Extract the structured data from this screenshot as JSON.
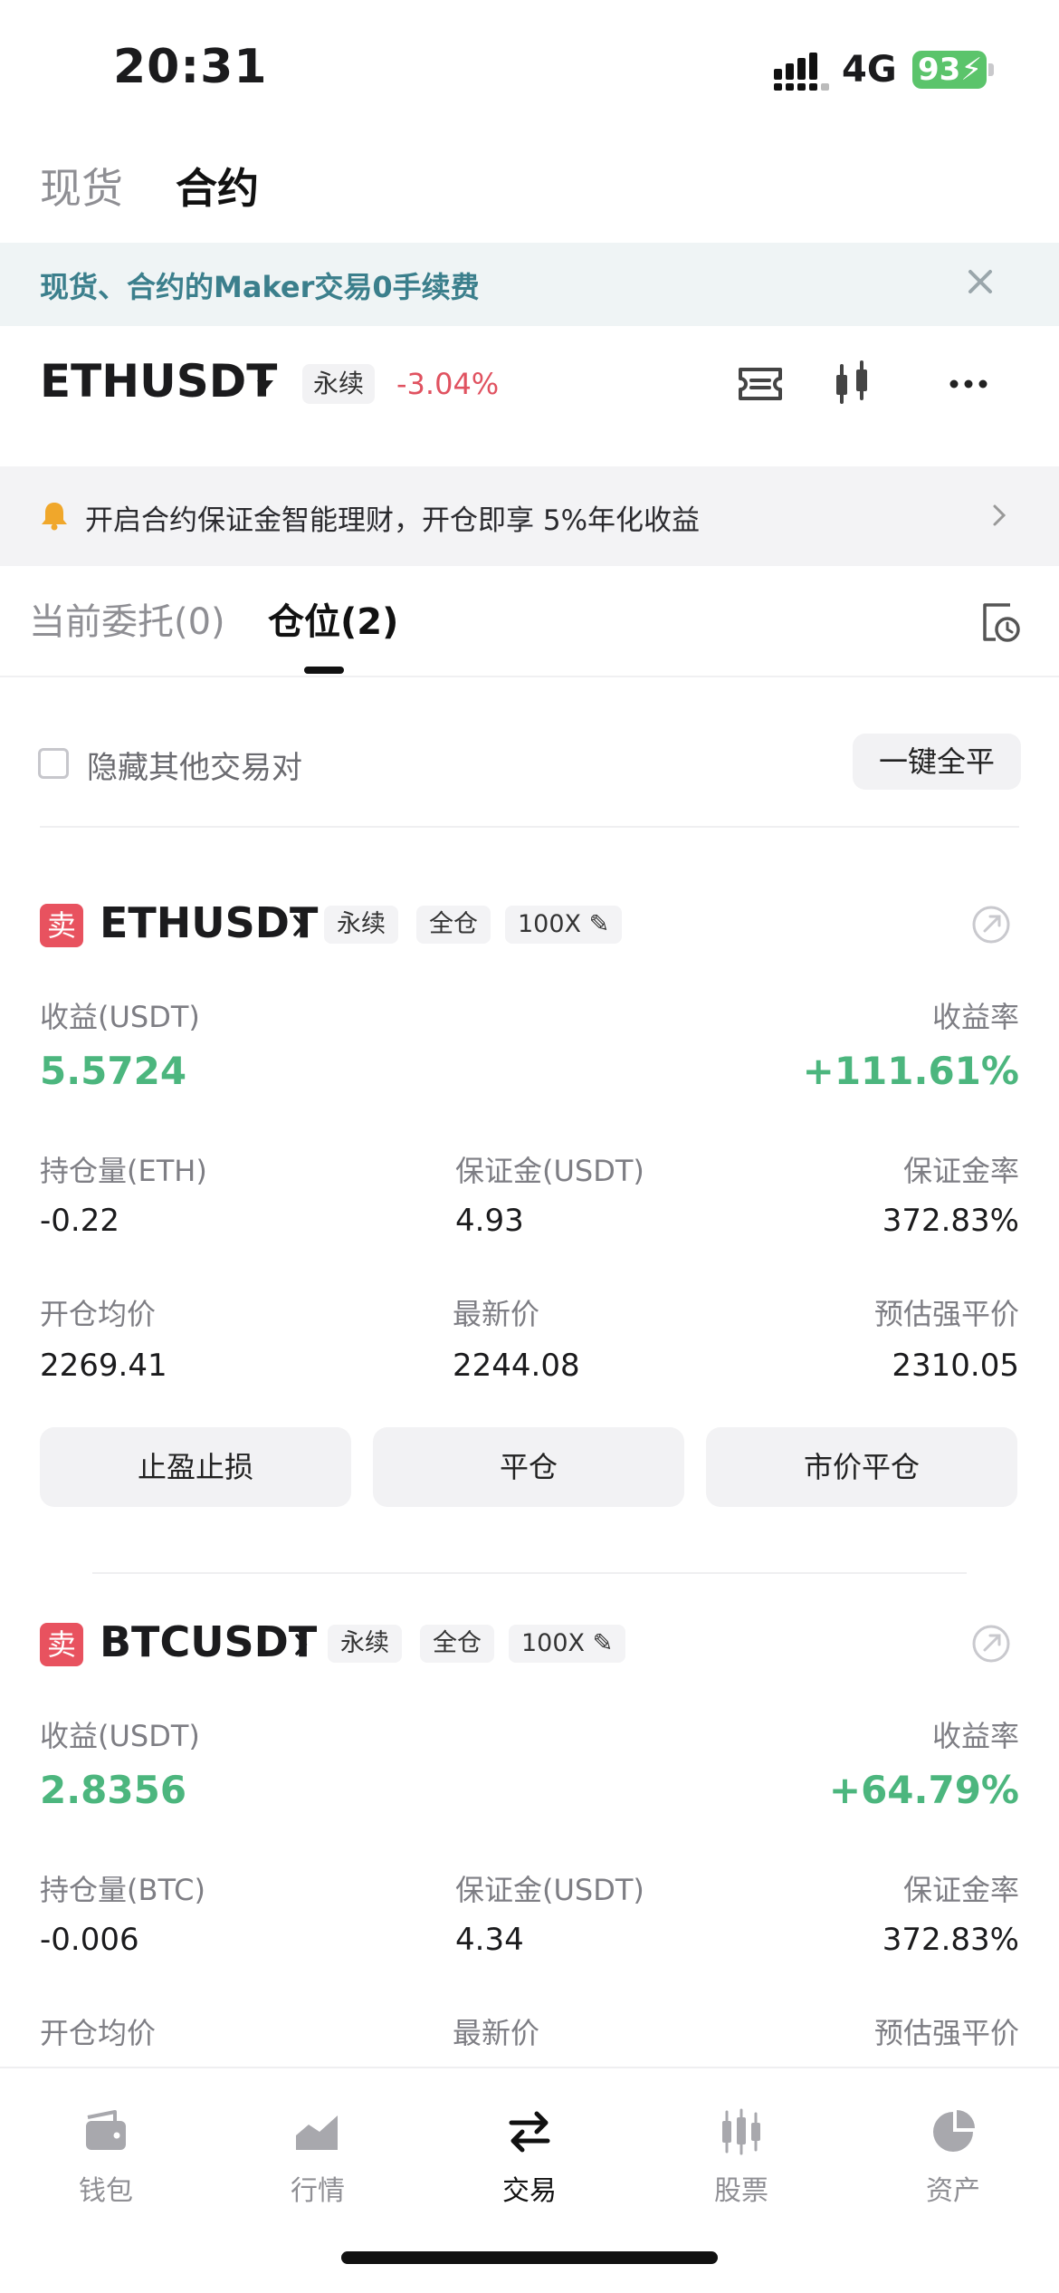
{
  "status_bar": {
    "time": "20:31",
    "network": "4G",
    "battery": "93"
  },
  "top_tabs": [
    {
      "label": "现货"
    },
    {
      "label": "合约"
    }
  ],
  "promo": {
    "text": "现货、合约的Maker交易0手续费"
  },
  "ticker": {
    "symbol": "ETHUSDT",
    "type_tag": "永续",
    "change": "-3.04%"
  },
  "notice": {
    "text": "开启合约保证金智能理财，开仓即享 5%年化收益"
  },
  "order_tabs": [
    {
      "label": "当前委托(0)"
    },
    {
      "label": "仓位(2)"
    }
  ],
  "hide_others": {
    "label": "隐藏其他交易对",
    "close_all": "一键全平"
  },
  "positions": [
    {
      "side": "卖",
      "symbol": "ETHUSDT",
      "tags": [
        "永续",
        "全仓",
        "100X"
      ],
      "pnl_label": "收益(USDT)",
      "pnl": "5.5724",
      "roe_label": "收益率",
      "roe": "+111.61%",
      "size_label": "持仓量(ETH)",
      "size": "-0.22",
      "margin_label": "保证金(USDT)",
      "margin": "4.93",
      "margin_ratio_label": "保证金率",
      "margin_ratio": "372.83%",
      "entry_label": "开仓均价",
      "entry": "2269.41",
      "mark_label": "最新价",
      "mark": "2244.08",
      "liq_label": "预估强平价",
      "liq": "2310.05",
      "actions": [
        "止盈止损",
        "平仓",
        "市价平仓"
      ]
    },
    {
      "side": "卖",
      "symbol": "BTCUSDT",
      "tags": [
        "永续",
        "全仓",
        "100X"
      ],
      "pnl_label": "收益(USDT)",
      "pnl": "2.8356",
      "roe_label": "收益率",
      "roe": "+64.79%",
      "size_label": "持仓量(BTC)",
      "size": "-0.006",
      "margin_label": "保证金(USDT)",
      "margin": "4.34",
      "margin_ratio_label": "保证金率",
      "margin_ratio": "372.83%",
      "entry_label": "开仓均价",
      "mark_label": "最新价",
      "liq_label": "预估强平价"
    }
  ],
  "bottom_nav": [
    {
      "label": "钱包",
      "icon": "wallet-icon"
    },
    {
      "label": "行情",
      "icon": "chart-icon"
    },
    {
      "label": "交易",
      "icon": "swap-icon",
      "active": true
    },
    {
      "label": "股票",
      "icon": "candles-icon"
    },
    {
      "label": "资产",
      "icon": "pie-icon"
    }
  ],
  "colors": {
    "up_green": "#4cb67e",
    "down_red": "#e05260",
    "sell_badge": "#e8525f",
    "promo_text": "#3b7f8c"
  }
}
